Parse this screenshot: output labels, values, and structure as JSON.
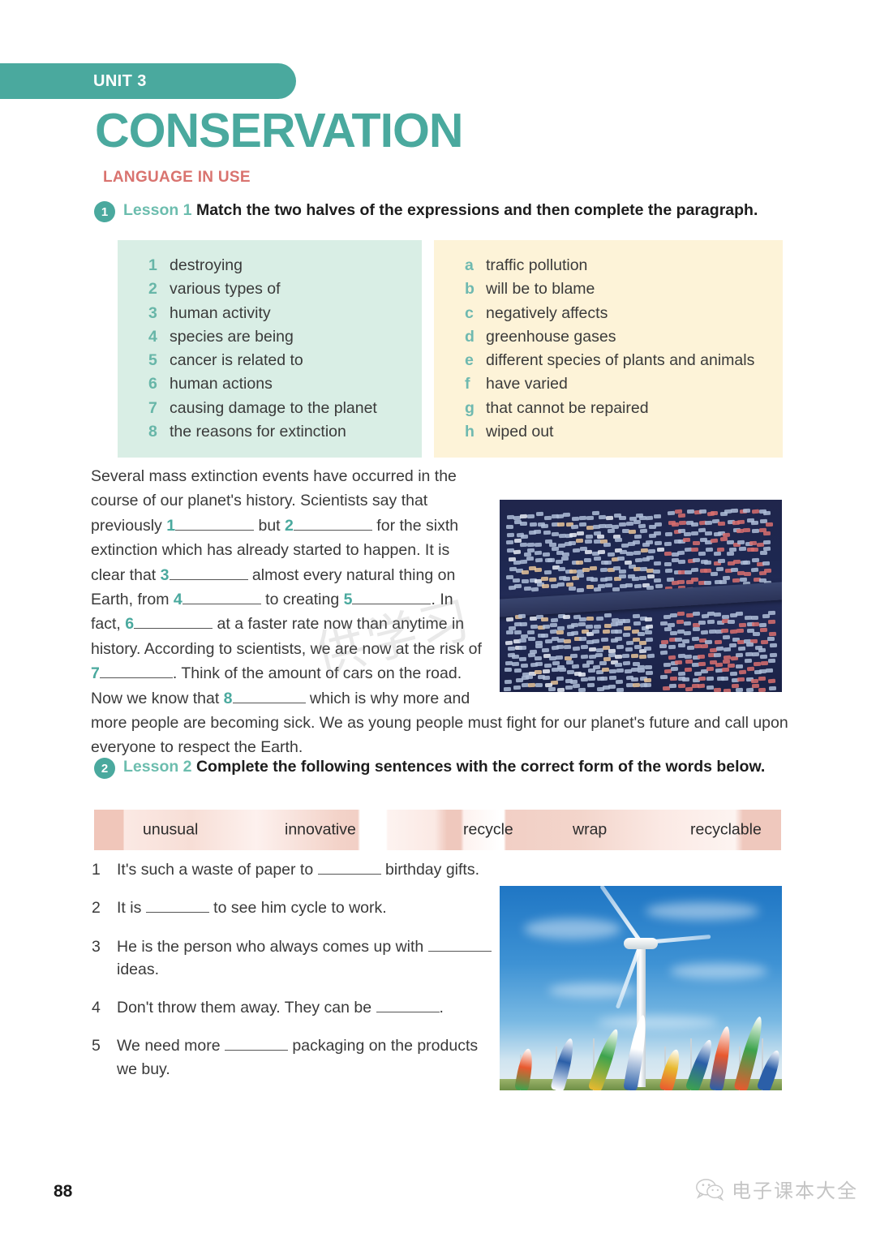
{
  "unit": {
    "label": "UNIT 3"
  },
  "title": "CONSERVATION",
  "section_label": "LANGUAGE IN USE",
  "exercise1": {
    "number": "1",
    "lesson": "Lesson 1",
    "instruction": "Match the two halves of the expressions and then complete the paragraph.",
    "left_column": [
      {
        "key": "1",
        "text": "destroying"
      },
      {
        "key": "2",
        "text": "various types of"
      },
      {
        "key": "3",
        "text": "human activity"
      },
      {
        "key": "4",
        "text": "species are being"
      },
      {
        "key": "5",
        "text": "cancer is related to"
      },
      {
        "key": "6",
        "text": "human actions"
      },
      {
        "key": "7",
        "text": "causing damage to the planet"
      },
      {
        "key": "8",
        "text": "the reasons for extinction"
      }
    ],
    "right_column": [
      {
        "key": "a",
        "text": "traffic pollution"
      },
      {
        "key": "b",
        "text": "will be to blame"
      },
      {
        "key": "c",
        "text": "negatively affects"
      },
      {
        "key": "d",
        "text": "greenhouse gases"
      },
      {
        "key": "e",
        "text": "different species of plants and animals"
      },
      {
        "key": "f",
        "text": "have varied"
      },
      {
        "key": "g",
        "text": "that cannot be repaired"
      },
      {
        "key": "h",
        "text": "wiped out"
      }
    ],
    "paragraph": {
      "p0": "Several mass extinction events have occurred in the course of our planet's history. Scientists say that previously ",
      "n1": "1",
      "p1": " but ",
      "n2": "2",
      "p2": " for the sixth extinction which has already started to happen. It is clear that ",
      "n3": "3",
      "p3": " almost every natural thing on Earth, from ",
      "n4": "4",
      "p4": " to creating ",
      "n5": "5",
      "p5": ". In fact, ",
      "n6": "6",
      "p6": " at a faster rate now than anytime in history. According to scientists, we are now at the risk of ",
      "n7": "7",
      "p7": ". Think of the amount of cars on the road. Now we know that ",
      "n8": "8",
      "p8": " which is why more and more people are becoming sick. We as young people must fight for our planet's future and call upon everyone to respect the Earth."
    },
    "image_traffic": "night-traffic-jam-photo"
  },
  "exercise2": {
    "number": "2",
    "lesson": "Lesson 2",
    "instruction": "Complete the following sentences with the correct form of the words below.",
    "word_bank": [
      "unusual",
      "innovative",
      "recycle",
      "wrap",
      "recyclable"
    ],
    "sentences": [
      {
        "num": "1",
        "pre": "It's such a waste of paper to ",
        "post": " birthday gifts."
      },
      {
        "num": "2",
        "pre": "It is ",
        "post": " to see him cycle to work."
      },
      {
        "num": "3",
        "pre": "He is the person who always comes up with ",
        "post": " ideas."
      },
      {
        "num": "4",
        "pre": "Don't throw them away. They can be ",
        "post": "."
      },
      {
        "num": "5",
        "pre": "We need more ",
        "post": " packaging on the products we buy."
      }
    ],
    "image_turbine": "wind-turbine-with-flags-photo"
  },
  "footer": {
    "page_number": "88",
    "watermark_text": "电子课本大全",
    "watermark_icon": "wechat-bubble-icon"
  },
  "watermark_overlay": "供学习",
  "colors": {
    "teal": "#4aa99e",
    "light_teal": "#6cbdae",
    "coral": "#d9736f",
    "mint_box": "#d9eee5",
    "cream_box": "#fdf3d8",
    "pink_band": "#f0c6ba"
  }
}
